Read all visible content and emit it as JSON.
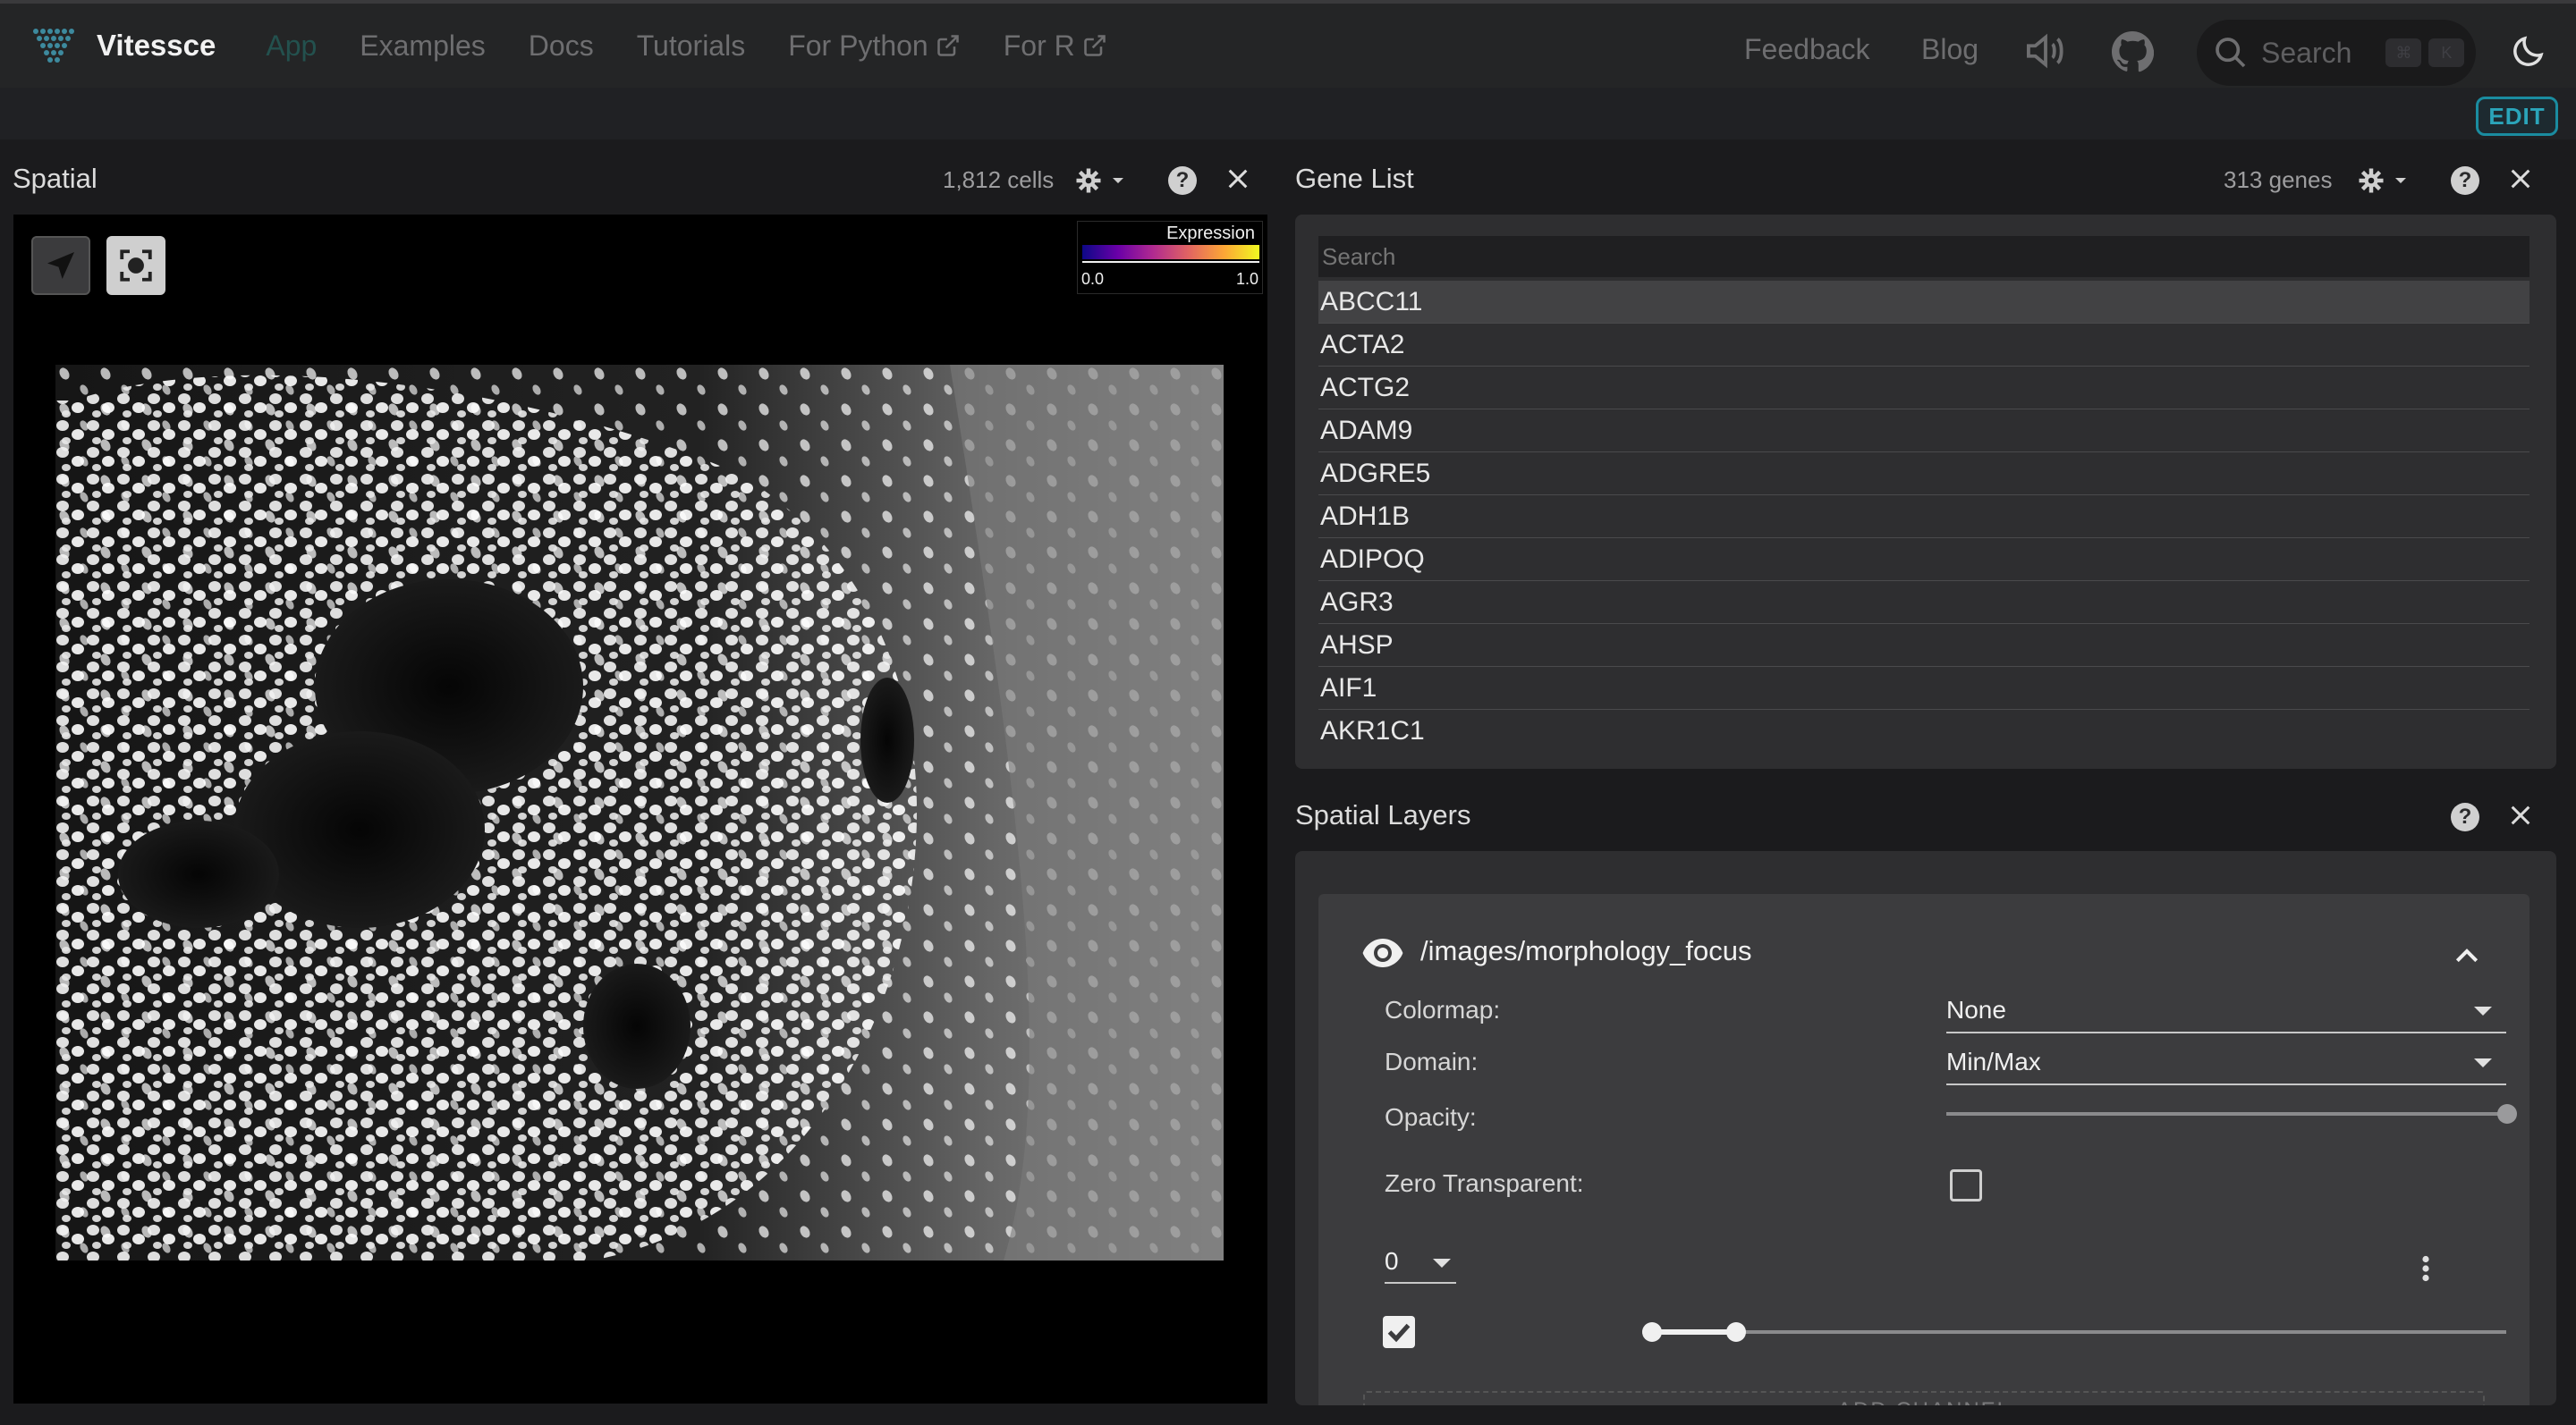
{
  "navbar": {
    "brand": "Vitessce",
    "links": [
      {
        "label": "App",
        "active": true
      },
      {
        "label": "Examples"
      },
      {
        "label": "Docs"
      },
      {
        "label": "Tutorials"
      },
      {
        "label": "For Python",
        "external": true
      },
      {
        "label": "For R",
        "external": true
      }
    ],
    "feedback": "Feedback",
    "blog": "Blog",
    "search_placeholder": "Search",
    "search_kbd": [
      "⌘",
      "K"
    ],
    "icons": [
      "volume-icon",
      "github-icon",
      "search-icon",
      "dark-mode-icon"
    ]
  },
  "subbar": {
    "edit_label": "EDIT"
  },
  "spatial": {
    "title": "Spatial",
    "count": "1,812 cells",
    "legend": {
      "title": "Expression",
      "min": "0.0",
      "max": "1.0"
    }
  },
  "gene_list": {
    "title": "Gene List",
    "count": "313 genes",
    "search_placeholder": "Search",
    "genes": [
      "ABCC11",
      "ACTA2",
      "ACTG2",
      "ADAM9",
      "ADGRE5",
      "ADH1B",
      "ADIPOQ",
      "AGR3",
      "AHSP",
      "AIF1",
      "AKR1C1"
    ],
    "selected": "ABCC11"
  },
  "layers": {
    "title": "Spatial Layers",
    "layer_name": "/images/morphology_focus",
    "colormap_label": "Colormap:",
    "colormap_value": "None",
    "domain_label": "Domain:",
    "domain_value": "Min/Max",
    "opacity_label": "Opacity:",
    "opacity_value": 1.0,
    "zero_transparent_label": "Zero Transparent:",
    "zero_transparent": false,
    "channel_select": "0",
    "channel_visible": true,
    "add_channel_label": "ADD CHANNEL"
  },
  "colors": {
    "accent": "#1a8ca0",
    "active_nav": "#23514e",
    "panel_bg": "#2e2e30",
    "card_bg": "#3c3c3e"
  }
}
